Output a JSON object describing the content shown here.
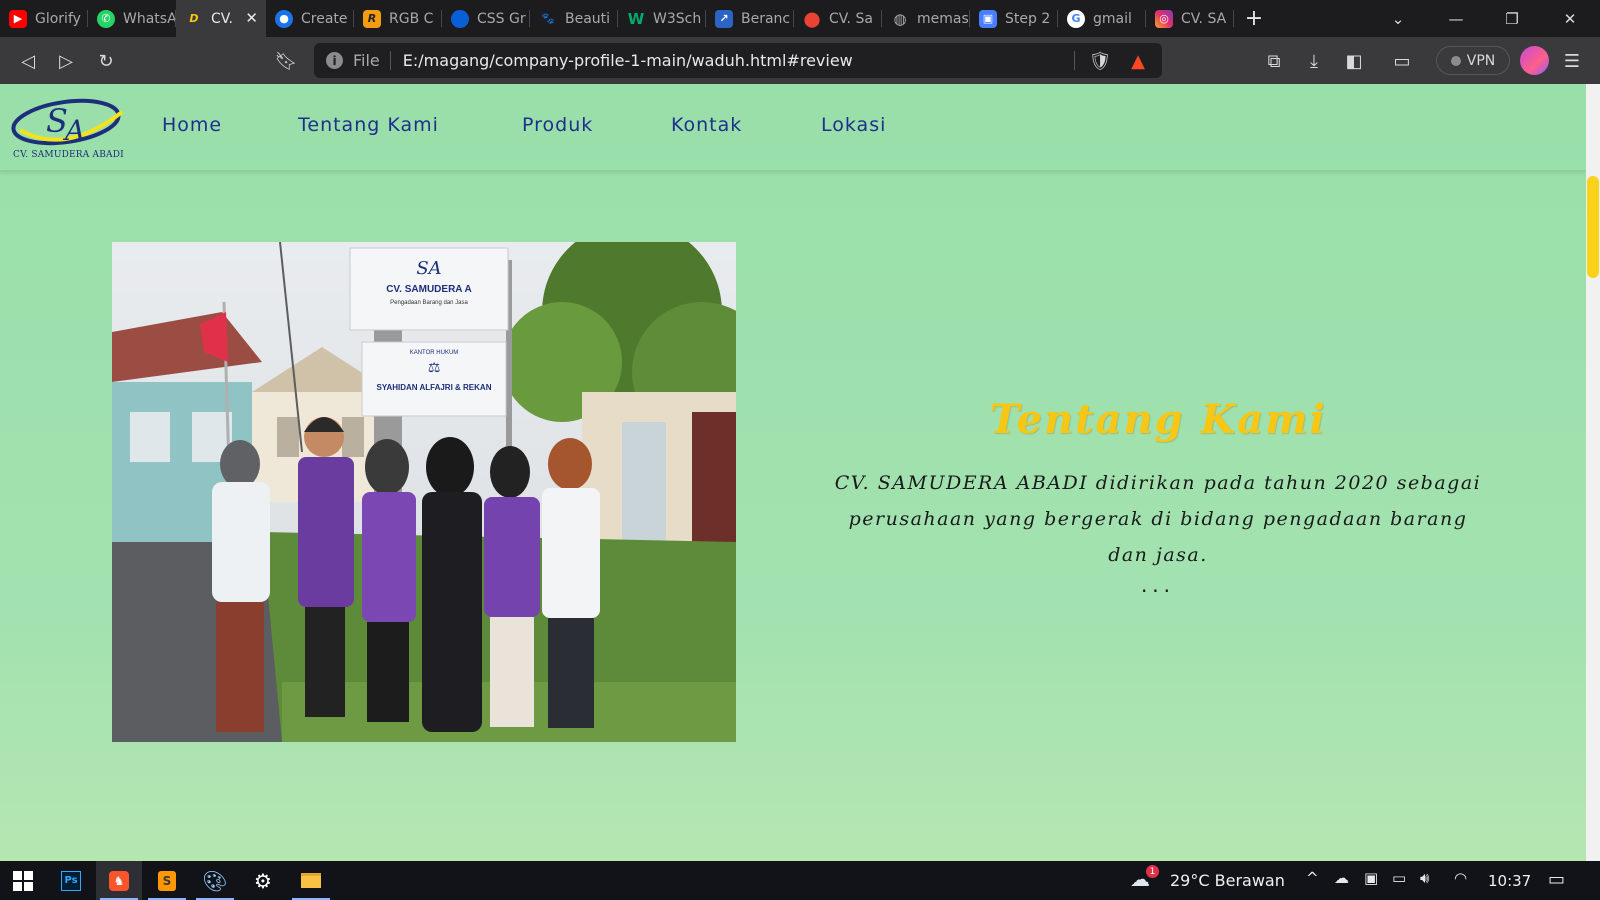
{
  "browser": {
    "tabs": [
      {
        "title": "Glorify",
        "icon": "youtube-icon",
        "color": "#ff0000"
      },
      {
        "title": "WhatsA",
        "icon": "whatsapp-icon",
        "color": "#25d366"
      },
      {
        "title": "CV.",
        "icon": "site-logo-icon",
        "color": "#3a3a3d",
        "active": true
      },
      {
        "title": "Create",
        "icon": "chrome-icon",
        "color": "#1a73e8"
      },
      {
        "title": "RGB C",
        "icon": "r-icon",
        "color": "#f39c12"
      },
      {
        "title": "CSS Gr",
        "icon": "css-icon",
        "color": "#0b5fd6"
      },
      {
        "title": "Beauti",
        "icon": "animal-icon",
        "color": "#6b6b6b"
      },
      {
        "title": "W3Sch",
        "icon": "w3schools-icon",
        "color": "#04aa6d"
      },
      {
        "title": "Beranc",
        "icon": "arrow-icon",
        "color": "#2b63c6"
      },
      {
        "title": "CV. Sa",
        "icon": "maps-pin-icon",
        "color": "#ea4335"
      },
      {
        "title": "memas",
        "icon": "globe-icon",
        "color": "#8b8b90"
      },
      {
        "title": "Step 2",
        "icon": "gift-icon",
        "color": "#4a7dff"
      },
      {
        "title": "gmail",
        "icon": "google-icon",
        "color": "#4285f4"
      },
      {
        "title": "CV. SA",
        "icon": "instagram-icon",
        "color": "#e1306c"
      }
    ],
    "address": {
      "scheme": "File",
      "url": "E:/magang/company-profile-1-main/waduh.html#review"
    },
    "vpn_label": "VPN"
  },
  "site": {
    "logo": {
      "letters": "SA",
      "caption": "CV. SAMUDERA ABADI"
    },
    "nav": [
      "Home",
      "Tentang Kami",
      "Produk",
      "Kontak",
      "Lokasi"
    ],
    "photo_signs": {
      "sign1_title": "CV. SAMUDERA A",
      "sign1_sub": "Pengadaan Barang dan Jasa",
      "sign2_head": "KANTOR HUKUM",
      "sign2_title": "SYAHIDAN ALFAJRI & REKAN"
    },
    "about": {
      "title": "Tentang Kami",
      "description": "CV. SAMUDERA ABADI didirikan pada tahun 2020 sebagai perusahaan yang bergerak di bidang pengadaan barang dan jasa.",
      "more": "..."
    }
  },
  "taskbar": {
    "weather": "29°C  Berawan",
    "weather_badge": "1",
    "time": "10:37"
  },
  "colors": {
    "page_bg": "#99dfaa",
    "nav_text": "#1e2f8c",
    "title_yellow": "#f8c614",
    "scroll_thumb": "#fbd21a"
  }
}
